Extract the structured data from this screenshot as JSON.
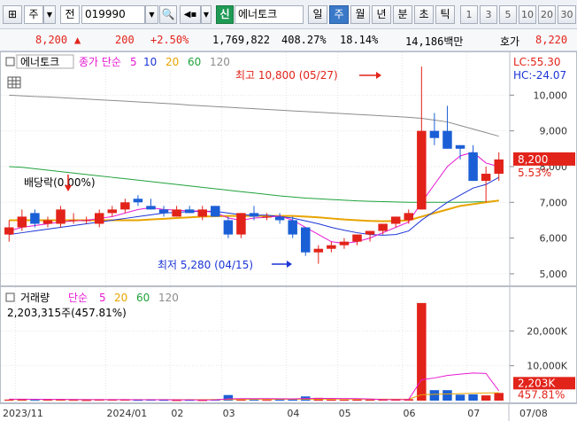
{
  "toolbar": {
    "market": "주",
    "price_type": "전",
    "code": "019990",
    "credit_badge": "신",
    "stock_name": "에너토크",
    "periods": [
      "일",
      "주",
      "월",
      "년",
      "분",
      "초",
      "틱"
    ],
    "active_period": "주",
    "minutes": [
      "1",
      "3",
      "5",
      "10",
      "20",
      "30"
    ]
  },
  "quote": {
    "price": "8,200",
    "change": "200",
    "change_pct": "+2.50%",
    "volume": "1,769,822",
    "vol_ratio": "408.27%",
    "turnover": "18.14%",
    "amount": "14,186백만",
    "ask_label": "호가",
    "ask": "8,220"
  },
  "price_panel": {
    "name": "에너토크",
    "legend_label": "종가 단순",
    "ma": [
      {
        "period": "5",
        "color": "#e619d2"
      },
      {
        "period": "10",
        "color": "#1b35d6"
      },
      {
        "period": "20",
        "color": "#e8a400"
      },
      {
        "period": "60",
        "color": "#1fa23b"
      },
      {
        "period": "120",
        "color": "#8c8c8c"
      }
    ],
    "lc": "LC:55.30",
    "hc": "HC:-24.07",
    "high_note": "최고 10,800 (05/27)",
    "low_note": "최저 5,280 (04/15)",
    "dividend_note": "배당락(0.00%)",
    "last_price": "8,200",
    "last_pct": "5.53%",
    "yticks": [
      "10,000",
      "9,000",
      "8,000",
      "7,000",
      "6,000",
      "5,000"
    ]
  },
  "volume_panel": {
    "title": "거래량",
    "legend_label": "단순",
    "ma": [
      {
        "period": "5",
        "color": "#e619d2"
      },
      {
        "period": "20",
        "color": "#e8a400"
      },
      {
        "period": "60",
        "color": "#1fa23b"
      },
      {
        "period": "120",
        "color": "#8c8c8c"
      }
    ],
    "info": "2,203,315주(457.81%)",
    "last": "2,203K",
    "last_pct": "457.81%",
    "yticks": [
      "20,000K",
      "10,000K"
    ]
  },
  "xaxis": [
    "2023/11",
    "2024/01",
    "02",
    "03",
    "04",
    "05",
    "06",
    "07",
    "07/08"
  ],
  "colors": {
    "up": "#e2231a",
    "down": "#1b5fd6"
  },
  "chart_data": {
    "type": "candlestick",
    "ylim": [
      4800,
      11000
    ],
    "candles": [
      {
        "o": 6100,
        "h": 6500,
        "l": 5900,
        "c": 6300
      },
      {
        "o": 6300,
        "h": 6800,
        "l": 6200,
        "c": 6600
      },
      {
        "o": 6700,
        "h": 6800,
        "l": 6300,
        "c": 6400
      },
      {
        "o": 6400,
        "h": 6600,
        "l": 6300,
        "c": 6500
      },
      {
        "o": 6400,
        "h": 6900,
        "l": 6300,
        "c": 6800
      },
      {
        "o": 6500,
        "h": 6700,
        "l": 6400,
        "c": 6500
      },
      {
        "o": 6500,
        "h": 6600,
        "l": 6400,
        "c": 6500
      },
      {
        "o": 6400,
        "h": 6800,
        "l": 6300,
        "c": 6700
      },
      {
        "o": 6700,
        "h": 6900,
        "l": 6600,
        "c": 6800
      },
      {
        "o": 6800,
        "h": 7100,
        "l": 6700,
        "c": 7000
      },
      {
        "o": 7100,
        "h": 7200,
        "l": 6900,
        "c": 7000
      },
      {
        "o": 6900,
        "h": 7100,
        "l": 6800,
        "c": 6800
      },
      {
        "o": 6800,
        "h": 6900,
        "l": 6600,
        "c": 6700
      },
      {
        "o": 6600,
        "h": 6900,
        "l": 6600,
        "c": 6800
      },
      {
        "o": 6800,
        "h": 6900,
        "l": 6700,
        "c": 6700
      },
      {
        "o": 6600,
        "h": 6900,
        "l": 6500,
        "c": 6800
      },
      {
        "o": 6900,
        "h": 6900,
        "l": 6600,
        "c": 6600
      },
      {
        "o": 6500,
        "h": 6600,
        "l": 6000,
        "c": 6100
      },
      {
        "o": 6100,
        "h": 6700,
        "l": 6000,
        "c": 6700
      },
      {
        "o": 6700,
        "h": 6900,
        "l": 6500,
        "c": 6600
      },
      {
        "o": 6600,
        "h": 6700,
        "l": 6500,
        "c": 6600
      },
      {
        "o": 6600,
        "h": 6700,
        "l": 6400,
        "c": 6500
      },
      {
        "o": 6500,
        "h": 6600,
        "l": 6000,
        "c": 6100
      },
      {
        "o": 6300,
        "h": 6300,
        "l": 5500,
        "c": 5600
      },
      {
        "o": 5600,
        "h": 5800,
        "l": 5280,
        "c": 5700
      },
      {
        "o": 5700,
        "h": 5900,
        "l": 5600,
        "c": 5800
      },
      {
        "o": 5800,
        "h": 6000,
        "l": 5700,
        "c": 5900
      },
      {
        "o": 5900,
        "h": 6100,
        "l": 5800,
        "c": 6100
      },
      {
        "o": 6100,
        "h": 6200,
        "l": 5900,
        "c": 6200
      },
      {
        "o": 6200,
        "h": 6400,
        "l": 6100,
        "c": 6400
      },
      {
        "o": 6400,
        "h": 6600,
        "l": 6300,
        "c": 6600
      },
      {
        "o": 6500,
        "h": 6800,
        "l": 6400,
        "c": 6700
      },
      {
        "o": 6800,
        "h": 10800,
        "l": 6800,
        "c": 9000
      },
      {
        "o": 9000,
        "h": 9500,
        "l": 8600,
        "c": 8800
      },
      {
        "o": 9000,
        "h": 9700,
        "l": 8500,
        "c": 8500
      },
      {
        "o": 8600,
        "h": 8600,
        "l": 8200,
        "c": 8500
      },
      {
        "o": 8400,
        "h": 8600,
        "l": 7600,
        "c": 7600
      },
      {
        "o": 7600,
        "h": 8000,
        "l": 7000,
        "c": 7800
      },
      {
        "o": 7800,
        "h": 8400,
        "l": 7600,
        "c": 8200
      }
    ],
    "ma5": [
      6200,
      6300,
      6350,
      6400,
      6450,
      6480,
      6500,
      6550,
      6600,
      6700,
      6800,
      6850,
      6800,
      6780,
      6760,
      6760,
      6720,
      6560,
      6500,
      6560,
      6580,
      6620,
      6500,
      6300,
      6100,
      5900,
      5850,
      5900,
      6000,
      6150,
      6300,
      6450,
      7000,
      7500,
      8000,
      8300,
      8400,
      8100,
      8000
    ],
    "ma10": [
      6100,
      6150,
      6200,
      6250,
      6300,
      6350,
      6400,
      6450,
      6500,
      6550,
      6600,
      6650,
      6700,
      6720,
      6740,
      6750,
      6750,
      6700,
      6650,
      6640,
      6640,
      6600,
      6560,
      6480,
      6400,
      6300,
      6220,
      6150,
      6100,
      6080,
      6100,
      6200,
      6500,
      6750,
      7000,
      7200,
      7400,
      7500,
      7700
    ],
    "ma20": [
      6500,
      6500,
      6500,
      6500,
      6500,
      6500,
      6500,
      6500,
      6500,
      6500,
      6500,
      6520,
      6540,
      6560,
      6580,
      6600,
      6610,
      6620,
      6620,
      6620,
      6620,
      6620,
      6620,
      6600,
      6580,
      6550,
      6520,
      6500,
      6480,
      6470,
      6480,
      6500,
      6600,
      6700,
      6800,
      6900,
      6950,
      7000,
      7050
    ],
    "ma60": [
      8000,
      7980,
      7940,
      7900,
      7860,
      7820,
      7780,
      7740,
      7700,
      7660,
      7620,
      7580,
      7540,
      7500,
      7460,
      7420,
      7380,
      7340,
      7300,
      7260,
      7220,
      7180,
      7150,
      7120,
      7100,
      7080,
      7060,
      7040,
      7030,
      7020,
      7010,
      7000,
      7000,
      7000,
      7000,
      7000,
      7010,
      7020,
      7050
    ],
    "ma120": [
      10000,
      9980,
      9960,
      9950,
      9930,
      9910,
      9890,
      9870,
      9850,
      9830,
      9810,
      9790,
      9770,
      9750,
      9720,
      9700,
      9680,
      9660,
      9640,
      9620,
      9600,
      9580,
      9560,
      9540,
      9520,
      9500,
      9480,
      9460,
      9440,
      9420,
      9400,
      9380,
      9350,
      9300,
      9250,
      9150,
      9050,
      8950,
      8850
    ],
    "volume_k": [
      300,
      500,
      200,
      300,
      400,
      200,
      150,
      350,
      250,
      300,
      200,
      250,
      200,
      150,
      200,
      150,
      300,
      1600,
      400,
      300,
      200,
      250,
      400,
      1200,
      800,
      300,
      250,
      300,
      250,
      300,
      300,
      400,
      28000,
      3000,
      3000,
      1700,
      1800,
      1500,
      2203
    ],
    "vol_ma5": [
      400,
      400,
      380,
      350,
      340,
      320,
      300,
      290,
      280,
      280,
      260,
      250,
      240,
      220,
      220,
      200,
      230,
      500,
      560,
      580,
      580,
      540,
      500,
      600,
      650,
      620,
      600,
      560,
      480,
      300,
      300,
      320,
      6000,
      6500,
      7200,
      7600,
      7900,
      7800,
      2800
    ],
    "vol_ma20": [
      350,
      350,
      350,
      340,
      330,
      320,
      310,
      300,
      300,
      290,
      280,
      280,
      280,
      290,
      300,
      300,
      310,
      330,
      350,
      360,
      370,
      380,
      390,
      400,
      420,
      430,
      430,
      420,
      420,
      400,
      400,
      410,
      1700,
      1800,
      1900,
      2000,
      2100,
      2200,
      2250
    ]
  }
}
